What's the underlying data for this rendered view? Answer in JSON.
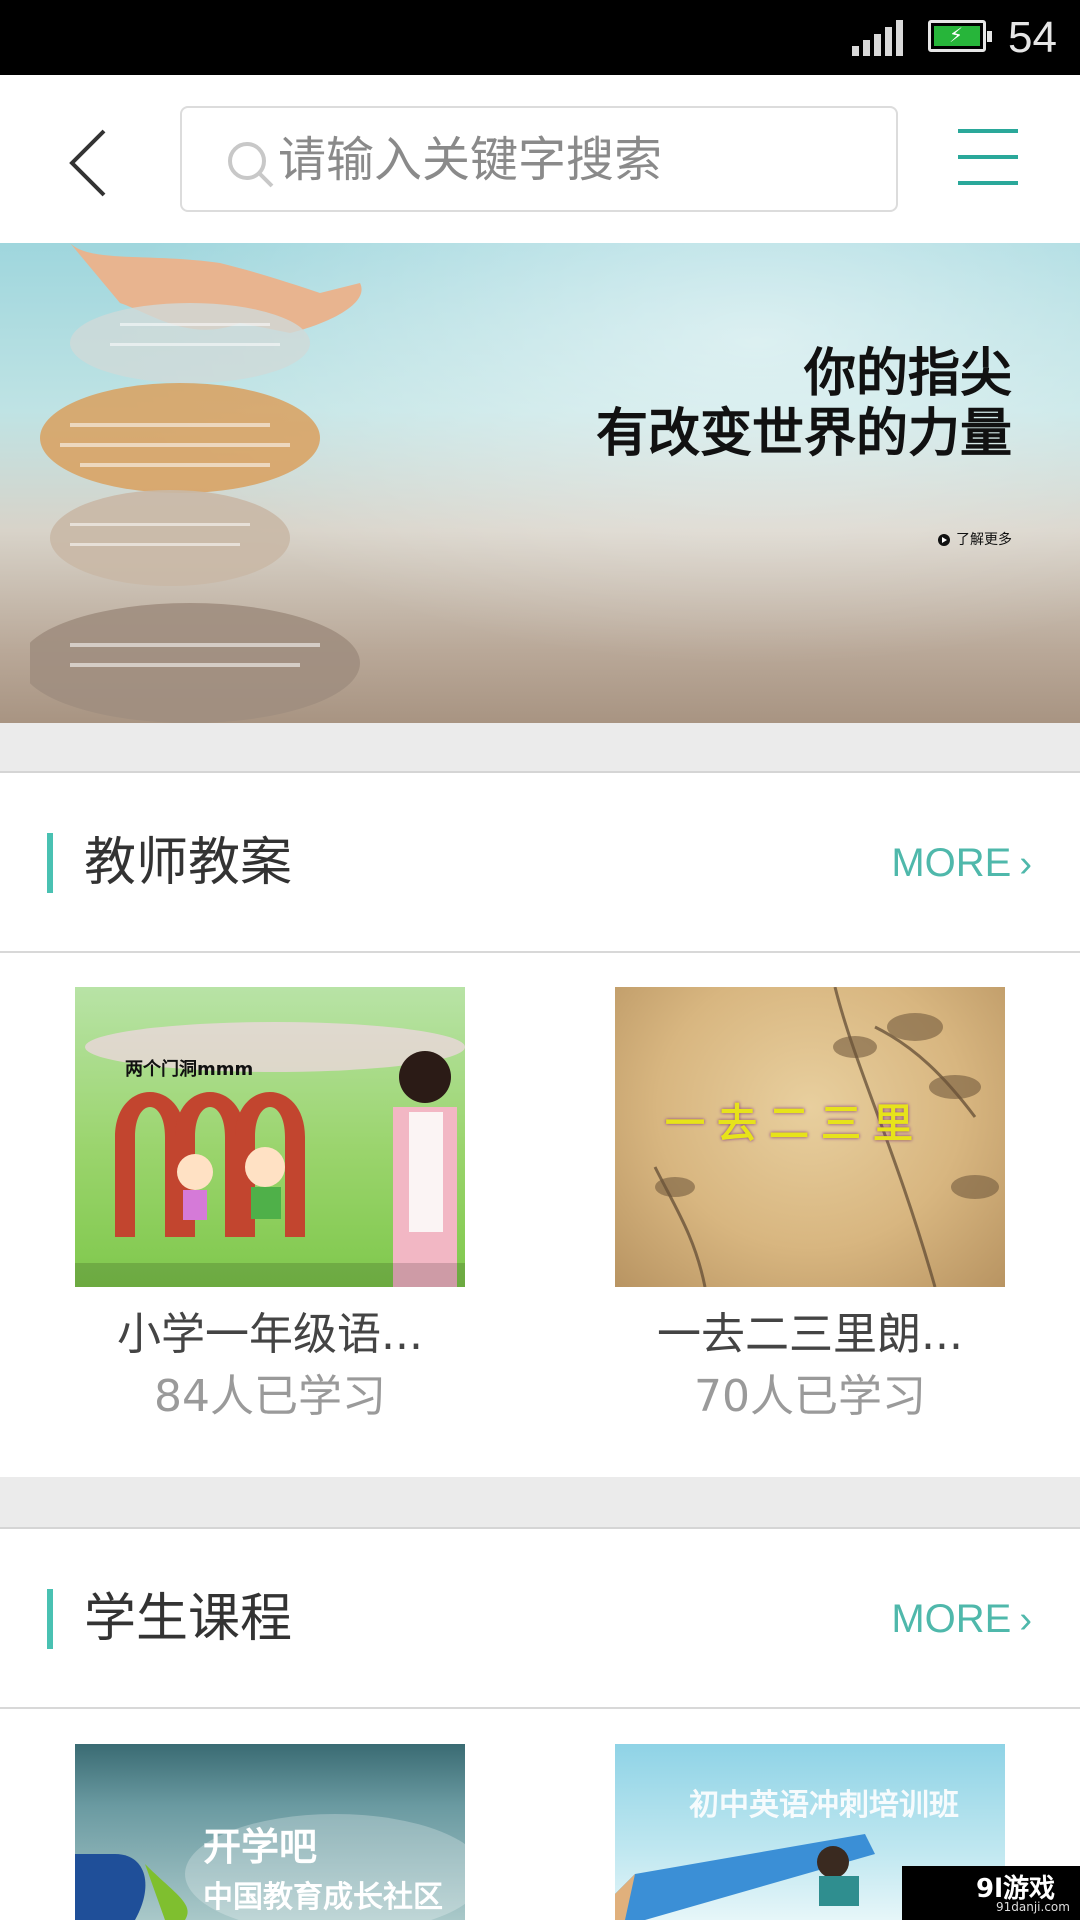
{
  "status_bar": {
    "battery_level": "54",
    "signal_icon": "signal-icon",
    "battery_icon": "battery-charging-icon"
  },
  "header": {
    "back_icon": "back-arrow-icon",
    "search_placeholder": "请输入关键字搜索",
    "search_icon": "search-icon",
    "menu_icon": "menu-icon"
  },
  "banner": {
    "line1": "你的指尖",
    "line2": "有改变世界的力量",
    "learn_more": "了解更多"
  },
  "sections": [
    {
      "title": "教师教案",
      "more": "MORE",
      "items": [
        {
          "name": "小学一年级语...",
          "count": "84人已学习",
          "thumb_caption": "两个门洞mmm"
        },
        {
          "name": "一去二三里朗...",
          "count": "70人已学习",
          "thumb_caption": "一去二三里"
        }
      ]
    },
    {
      "title": "学生课程",
      "more": "MORE",
      "items": [
        {
          "thumb_caption": "开学吧",
          "thumb_caption2": "中国教育成长社区"
        },
        {
          "thumb_caption": "初中英语冲刺培训班"
        }
      ]
    }
  ],
  "watermark": {
    "brand": "9l游戏",
    "domain": "91danji.com"
  },
  "colors": {
    "accent": "#49c1b2",
    "more": "#4fb8ab",
    "menu": "#2aa89a"
  }
}
